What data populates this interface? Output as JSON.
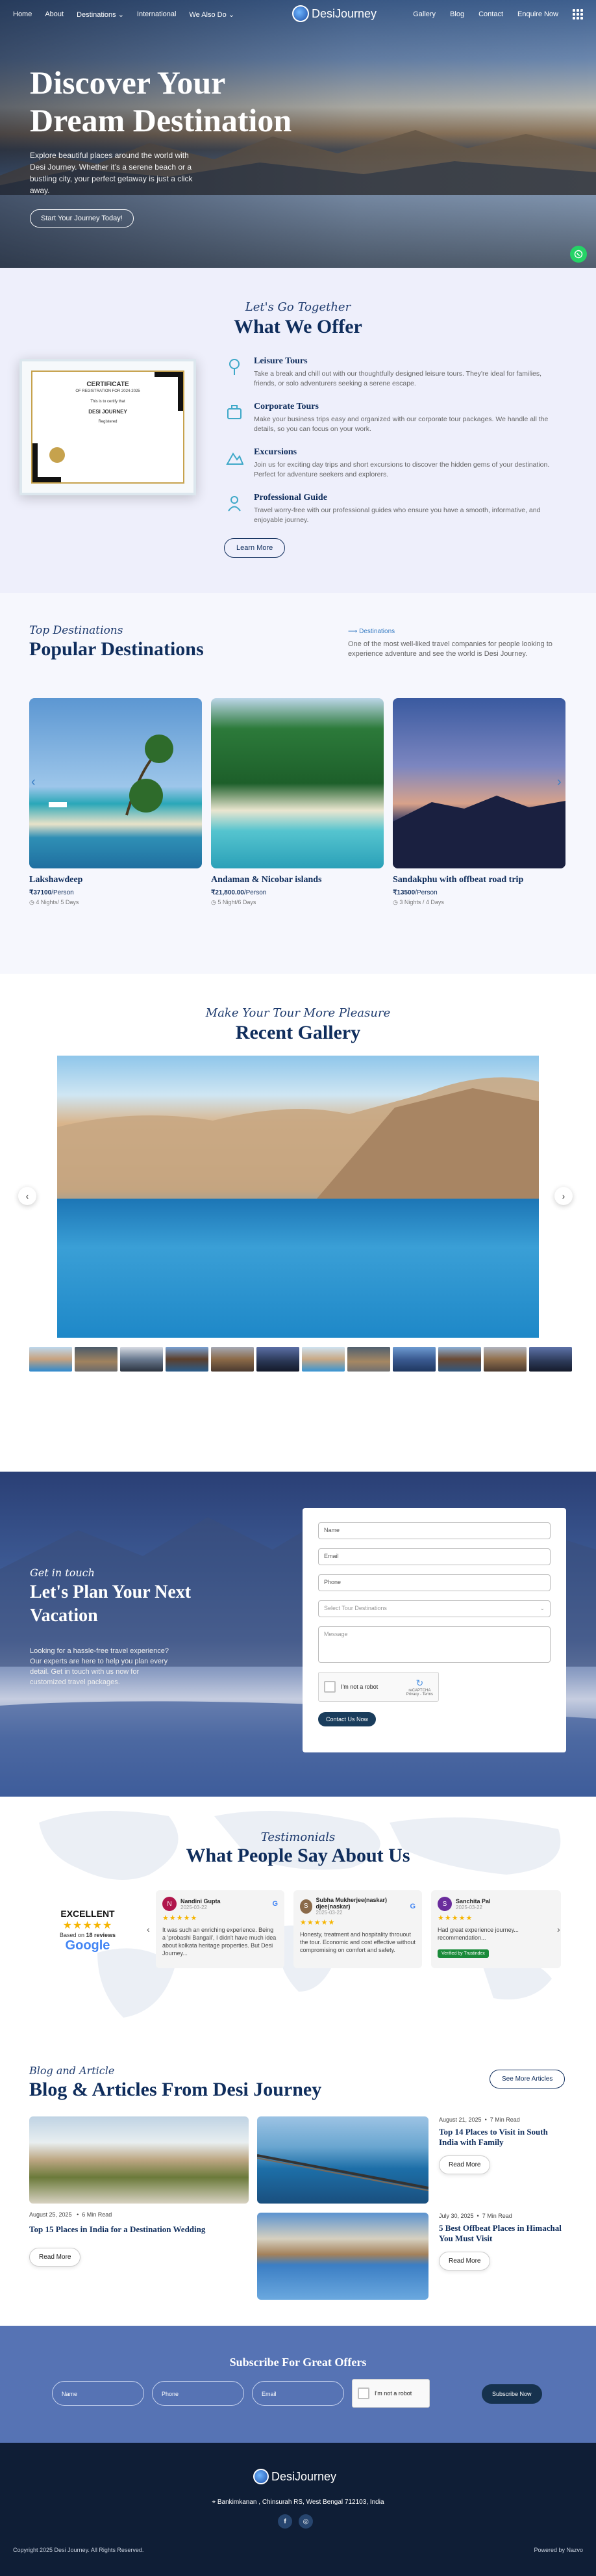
{
  "nav": {
    "links": [
      "Home",
      "About",
      "Destinations",
      "International",
      "We Also Do"
    ],
    "right": [
      "Gallery",
      "Blog",
      "Contact",
      "Enquire Now"
    ],
    "brand": "DesiJourney"
  },
  "hero": {
    "title_line1": "Discover Your",
    "title_line2": "Dream Destination",
    "text": "Explore beautiful places around the world with Desi Journey. Whether it’s a serene beach or a bustling city, your perfect getaway is just a click away.",
    "cta": "Start Your Journey Today!"
  },
  "offer": {
    "script": "Let's Go Together",
    "title": "What We Offer",
    "certificate": {
      "heading": "CERTIFICATE",
      "sub": "OF REGISTRATION FOR 2024-2025",
      "line": "This is to certify that",
      "name": "DESI JOURNEY",
      "foot": "Registered"
    },
    "items": [
      {
        "title": "Leisure Tours",
        "text": "Take a break and chill out with our thoughtfully designed leisure tours. They're ideal for families, friends, or solo adventurers seeking a serene escape."
      },
      {
        "title": "Corporate Tours",
        "text": "Make your business trips easy and organized with our corporate tour packages. We handle all the details, so you can focus on your work."
      },
      {
        "title": "Excursions",
        "text": "Join us for exciting day trips and short excursions to discover the hidden gems of your destination. Perfect for adventure seekers and explorers."
      },
      {
        "title": "Professional Guide",
        "text": "Travel worry-free with our professional guides who ensure you have a smooth, informative, and enjoyable journey."
      }
    ],
    "button": "Learn More"
  },
  "dest": {
    "script": "Top Destinations",
    "title": "Popular Destinations",
    "tag": "Destinations",
    "desc": "One of the most well-liked travel companies for people looking to experience adventure and see the world is Desi Journey.",
    "cards": [
      {
        "name": "Lakshawdeep",
        "price": "₹37100",
        "per": "/Person",
        "duration": "4 Nights/ 5 Days"
      },
      {
        "name": "Andaman & Nicobar islands",
        "price": "₹21,800.00",
        "per": "/Person",
        "duration": "5 Night/6 Days"
      },
      {
        "name": "Sandakphu with offbeat road trip",
        "price": "₹13500",
        "per": "/Person",
        "duration": "3 Nights / 4 Days"
      }
    ]
  },
  "gallery": {
    "script": "Make Your Tour More Pleasure",
    "title": "Recent Gallery"
  },
  "plan": {
    "script": "Get in touch",
    "title_line1": "Let's Plan Your Next",
    "title_line2": "Vacation",
    "text": "Looking for a hassle-free travel experience? Our experts are here to help you plan every detail. Get in touch with us now for customized travel packages.",
    "form": {
      "name": "Name",
      "email": "Email",
      "phone": "Phone",
      "select": "Select Tour Destinations",
      "message": "Message",
      "captcha": "I'm not a robot",
      "captcha_brand": "reCAPTCHA",
      "captcha_sub": "Privacy - Terms",
      "submit": "Contact Us Now"
    }
  },
  "test": {
    "script": "Testimonials",
    "title": "What People Say About Us",
    "rating_word": "EXCELLENT",
    "based": "Based on",
    "count": "18 reviews",
    "google": "Google",
    "reviews": [
      {
        "initial": "N",
        "name": "Nandini Gupta",
        "date": "2025-03-22",
        "text": "It was such an enriching experience. Being a 'probashi Bangali', I didn't have much idea about kolkata heritage properties. But Desi Journey..."
      },
      {
        "initial": "S",
        "name": "Subha Mukherjee(naskar) djee(naskar)",
        "date": "2025-03-22",
        "text": "Honesty, treatment and hospitality throuout the tour. Economic and cost effective without compromising on comfort and safety."
      },
      {
        "initial": "S",
        "name": "Sanchita Pal",
        "date": "2025-03-22",
        "text": "Had great experience journey... recommendation..."
      }
    ],
    "verified": "Verified by Trustindex"
  },
  "blog": {
    "script": "Blog and Article",
    "title": "Blog & Articles From Desi Journey",
    "see_more": "See More Articles",
    "main": {
      "date": "August 25, 2025",
      "read": "6 Min Read",
      "title": "Top 15 Places in India for a Destination Wedding",
      "btn": "Read More"
    },
    "side": [
      {
        "date": "August 21, 2025",
        "read": "7 Min Read",
        "title": "Top 14 Places to Visit in South India with Family",
        "btn": "Read More"
      },
      {
        "date": "July 30, 2025",
        "read": "7 Min Read",
        "title": "5 Best Offbeat Places in Himachal You Must Visit",
        "btn": "Read More"
      }
    ]
  },
  "subscribe": {
    "title": "Subscribe For Great Offers",
    "name": "Name",
    "phone": "Phone",
    "email": "Email",
    "captcha": "I'm not a robot",
    "button": "Subscribe Now"
  },
  "footer": {
    "brand": "DesiJourney",
    "address": "Bankimkanan , Chinsurah RS, West Bengal 712103, India",
    "copyright": "Copyright 2025 Desi Journey. All Rights Reserved.",
    "powered": "Powered by Nazvo"
  },
  "colors": {
    "navy": "#0f2d5c",
    "footer": "#0f1e36",
    "subscribe": "#5673b4",
    "whatsapp": "#25d366",
    "star": "#f5b400"
  }
}
